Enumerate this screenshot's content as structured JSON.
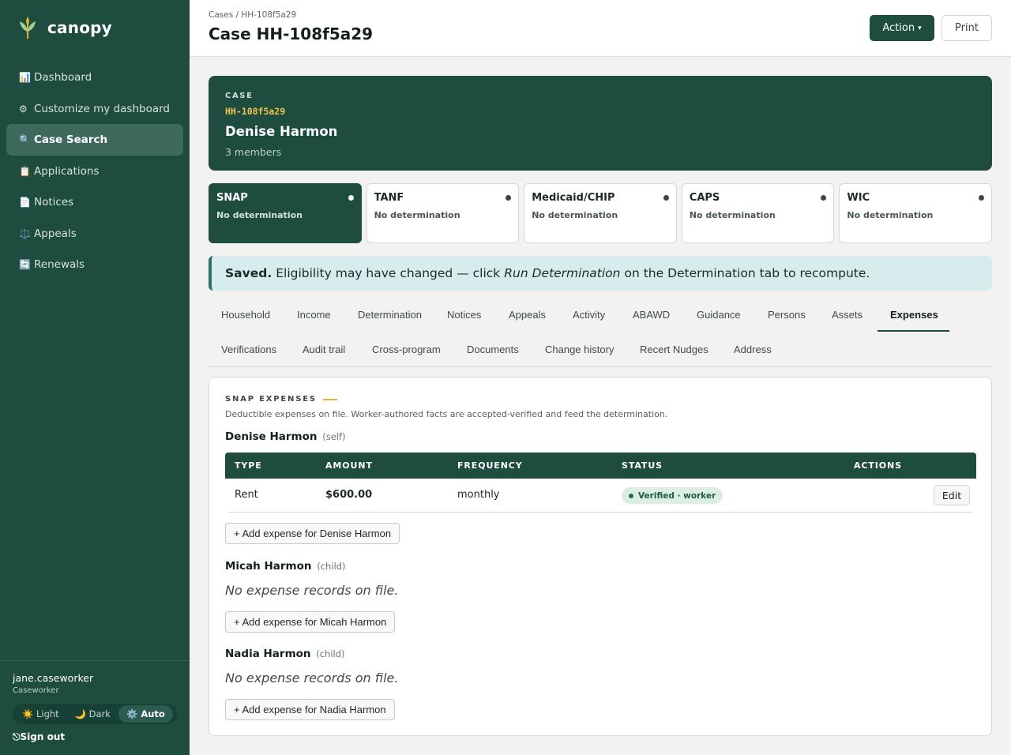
{
  "app": {
    "name": "canopy",
    "icon": "wheat-sprout-icon"
  },
  "sidebar": {
    "items": [
      {
        "icon": "📊",
        "label": "Dashboard"
      },
      {
        "icon": "⚙",
        "label": "Customize my dashboard"
      },
      {
        "icon": "🔍",
        "label": "Case Search",
        "active": true
      },
      {
        "icon": "📋",
        "label": "Applications"
      },
      {
        "icon": "📄",
        "label": "Notices"
      },
      {
        "icon": "⚖️",
        "label": "Appeals"
      },
      {
        "icon": "🔄",
        "label": "Renewals"
      }
    ],
    "user": {
      "name": "jane.caseworker",
      "role": "Caseworker"
    },
    "theme": {
      "light": {
        "icon": "☀️",
        "label": "Light"
      },
      "dark": {
        "icon": "🌙",
        "label": "Dark"
      },
      "auto": {
        "icon": "⚙️",
        "label": "Auto"
      },
      "selected": "Auto"
    },
    "signout": {
      "icon": "⎋",
      "label": "Sign out"
    }
  },
  "header": {
    "breadcrumb": "Cases / HH-108f5a29",
    "title": "Case HH-108f5a29",
    "action_label": "Action",
    "action_caret": "▾",
    "print_label": "Print"
  },
  "case": {
    "label": "CASE",
    "id": "HH-108f5a29",
    "name": "Denise Harmon",
    "members": "3 members"
  },
  "programs": [
    {
      "name": "SNAP",
      "status": "No determination",
      "active": true
    },
    {
      "name": "TANF",
      "status": "No determination"
    },
    {
      "name": "Medicaid/CHIP",
      "status": "No determination"
    },
    {
      "name": "CAPS",
      "status": "No determination"
    },
    {
      "name": "WIC",
      "status": "No determination"
    }
  ],
  "banner": {
    "strong": "Saved.",
    "before": "Eligibility may have changed — click",
    "em": "Run Determination",
    "after": "on the Determination tab to recompute."
  },
  "tabs": {
    "row1": [
      "Household",
      "Income",
      "Determination",
      "Notices",
      "Appeals",
      "Activity",
      "ABAWD",
      "Guidance",
      "Persons",
      "Assets",
      "Expenses"
    ],
    "row2": [
      "Verifications",
      "Audit trail",
      "Cross-program",
      "Documents",
      "Change history",
      "Recert Nudges",
      "Address"
    ],
    "active": "Expenses"
  },
  "expenses": {
    "heading": "SNAP EXPENSES",
    "description": "Deductible expenses on file. Worker-authored facts are accepted-verified and feed the determination.",
    "columns": [
      "TYPE",
      "AMOUNT",
      "FREQUENCY",
      "STATUS",
      "ACTIONS"
    ],
    "persons": [
      {
        "name": "Denise Harmon",
        "relation": "(self)",
        "rows": [
          {
            "type": "Rent",
            "amount": "$600.00",
            "frequency": "monthly",
            "status": "Verified · worker",
            "action": "Edit"
          }
        ],
        "add_label": "+ Add expense for Denise Harmon"
      },
      {
        "name": "Micah Harmon",
        "relation": "(child)",
        "empty": "No expense records on file.",
        "add_label": "+ Add expense for Micah Harmon"
      },
      {
        "name": "Nadia Harmon",
        "relation": "(child)",
        "empty": "No expense records on file.",
        "add_label": "+ Add expense for Nadia Harmon"
      }
    ]
  },
  "colors": {
    "brand": "#1e4d40",
    "accent": "#f0c44a",
    "verified": "#1f6b44"
  }
}
